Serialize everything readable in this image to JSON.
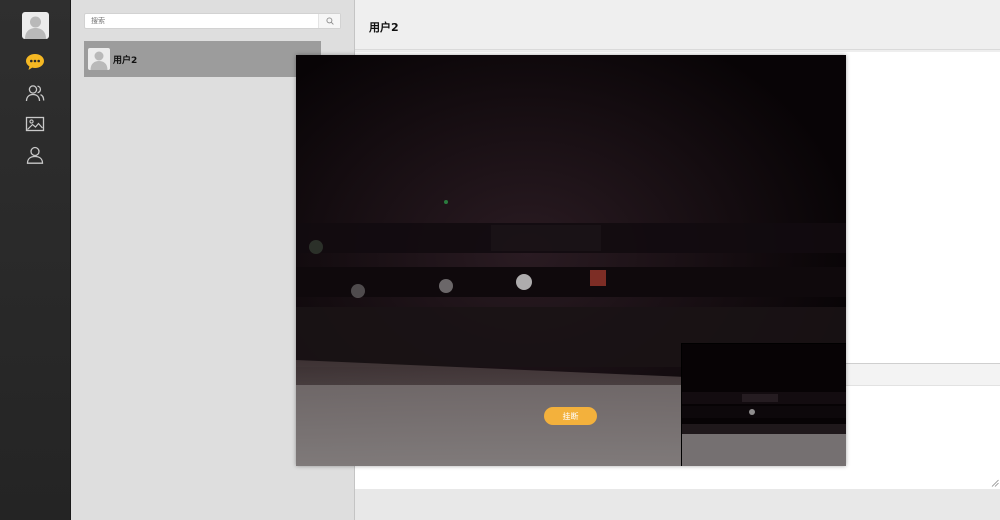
{
  "sidebar": {
    "avatar_icon": "user-avatar-placeholder",
    "nav": [
      {
        "name": "chat-bubble-icon",
        "active": true
      },
      {
        "name": "contacts-icon",
        "active": false
      },
      {
        "name": "image-icon",
        "active": false
      },
      {
        "name": "profile-icon",
        "active": false
      }
    ]
  },
  "search": {
    "placeholder": "搜索",
    "value": "",
    "icon": "search-icon"
  },
  "contacts": [
    {
      "name": "用户2",
      "avatar": "user-avatar-placeholder",
      "selected": true
    }
  ],
  "chat": {
    "title": "用户2"
  },
  "video_call": {
    "hangup_label": "挂断",
    "remote_feed": "camera-feed-remote",
    "local_preview": "camera-feed-local"
  },
  "colors": {
    "sidebar_bg": "#2a2a2a",
    "active_icon": "#f5b823",
    "hangup_button": "#f3b13c",
    "selected_contact_bg": "#9c9c9c"
  }
}
